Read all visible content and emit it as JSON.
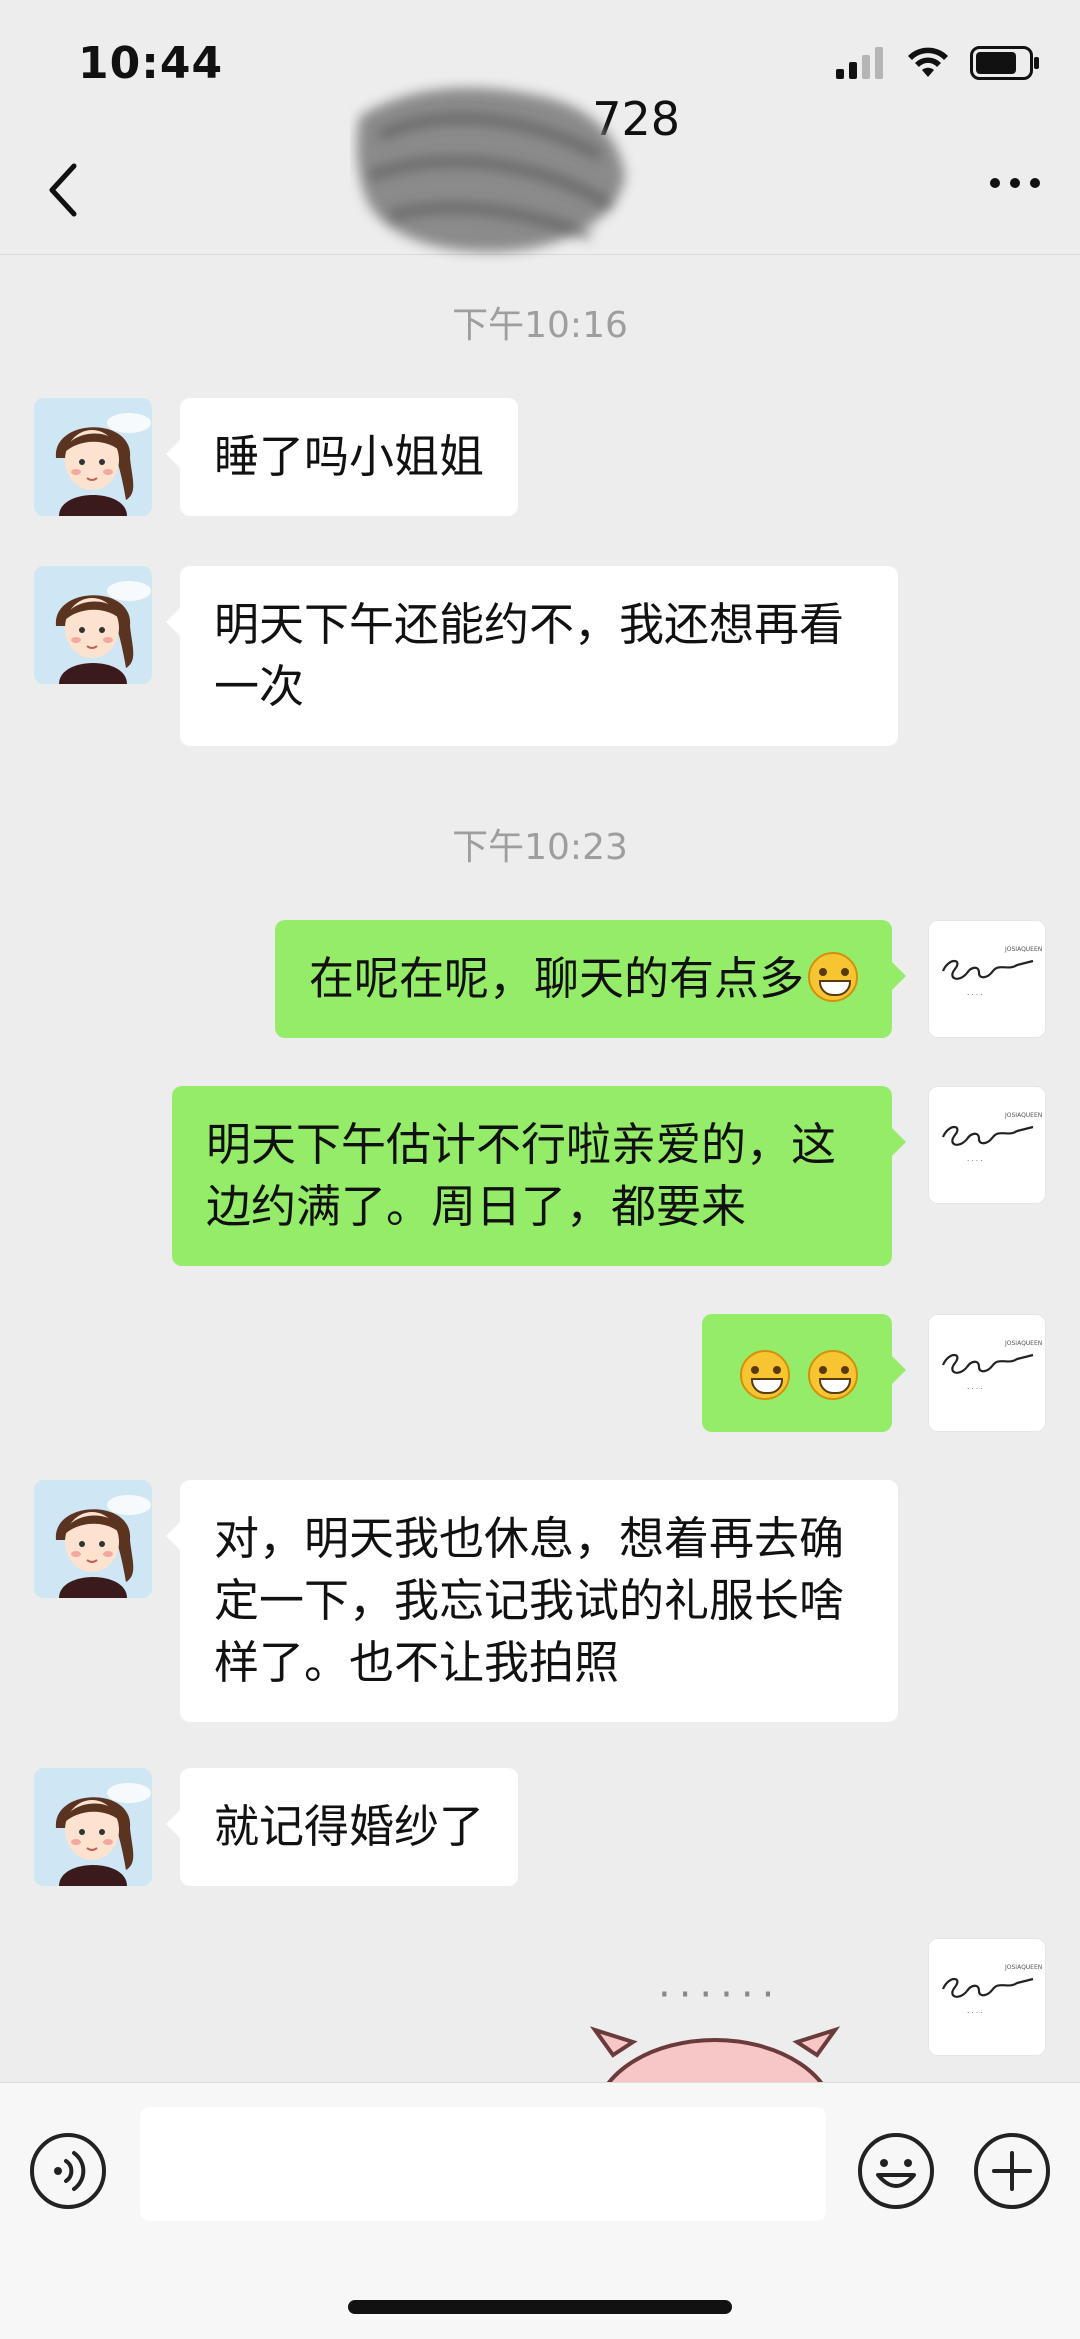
{
  "status_bar": {
    "time": "10:44"
  },
  "header": {
    "title": "728"
  },
  "messages": [
    {
      "type": "time",
      "text": "下午10:16"
    },
    {
      "type": "in",
      "text": "睡了吗小姐姐"
    },
    {
      "type": "in",
      "text": "明天下午还能约不，我还想再看一次"
    },
    {
      "type": "time",
      "text": "下午10:23"
    },
    {
      "type": "out",
      "text": "在呢在呢，聊天的有点多"
    },
    {
      "type": "out",
      "text": "明天下午估计不行啦亲爱的，这边约满了。周日了，都要来"
    },
    {
      "type": "out",
      "text": ""
    },
    {
      "type": "in",
      "text": "对，明天我也休息，想着再去确定一下，我忘记我试的礼服长啥样了。也不让我拍照"
    },
    {
      "type": "in",
      "text": "就记得婚纱了"
    },
    {
      "type": "sticker",
      "text": "······"
    }
  ],
  "input": {
    "placeholder": ""
  },
  "colors": {
    "outgoing": "#95ec69",
    "incoming": "#ffffff",
    "background": "#ededed"
  }
}
